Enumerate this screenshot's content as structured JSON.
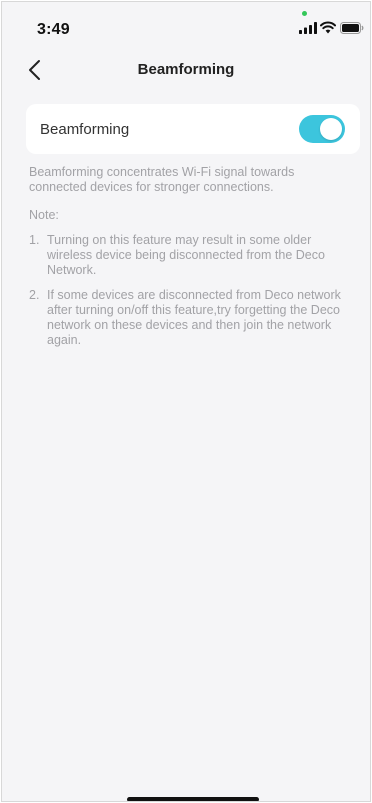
{
  "status_bar": {
    "time": "3:49",
    "icons": [
      "signal-icon",
      "wifi-icon",
      "battery-icon"
    ]
  },
  "nav": {
    "title": "Beamforming",
    "back_icon": "chevron-left-icon"
  },
  "setting": {
    "label": "Beamforming",
    "toggle_on": true
  },
  "description": "Beamforming concentrates Wi-Fi signal towards connected devices for stronger connections.",
  "note": {
    "label": "Note:",
    "items": [
      {
        "number": "1.",
        "text": "Turning on this feature may result in some older wireless device being disconnected from the Deco Network."
      },
      {
        "number": "2.",
        "text": "If some devices are disconnected from Deco network after turning on/off this feature,try forgetting the Deco network on these devices and then join the network again."
      }
    ]
  },
  "colors": {
    "accent": "#3cc5dd",
    "status_dot": "#34c759",
    "background": "#f5f5f7",
    "muted_text": "#a2a2a6"
  }
}
